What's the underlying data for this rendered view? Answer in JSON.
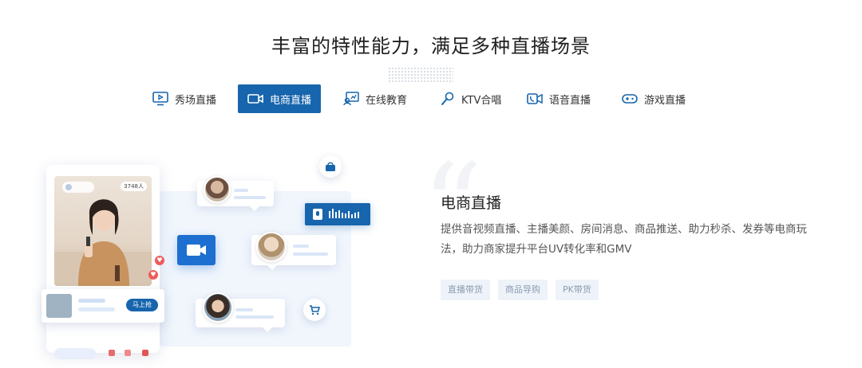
{
  "section": {
    "title": "丰富的特性能力，满足多种直播场景"
  },
  "tabs": [
    {
      "label": "秀场直播",
      "icon": "monitor-play-icon",
      "active": false
    },
    {
      "label": "电商直播",
      "icon": "video-camera-icon",
      "active": true
    },
    {
      "label": "在线教育",
      "icon": "teacher-board-icon",
      "active": false
    },
    {
      "label": "KTV合唱",
      "icon": "microphone-icon",
      "active": false
    },
    {
      "label": "语音直播",
      "icon": "voice-call-icon",
      "active": false
    },
    {
      "label": "游戏直播",
      "icon": "gamepad-icon",
      "active": false
    }
  ],
  "illustration": {
    "viewer_count": "3748人",
    "buy_button": "马上抢",
    "icons": [
      "shopping-bag-icon",
      "cart-icon",
      "video-camera-icon",
      "mic-audio-icon",
      "heart-icon"
    ]
  },
  "feature": {
    "title": "电商直播",
    "description": "提供音视频直播、主播美颜、房间消息、商品推送、助力秒杀、发券等电商玩法，助力商家提升平台UV转化率和GMV",
    "tags": [
      "直播带货",
      "商品导购",
      "PK带货"
    ]
  },
  "colors": {
    "accent": "#1765ad",
    "tag_bg": "#eef3f9",
    "tag_text": "#8a9bb0"
  }
}
